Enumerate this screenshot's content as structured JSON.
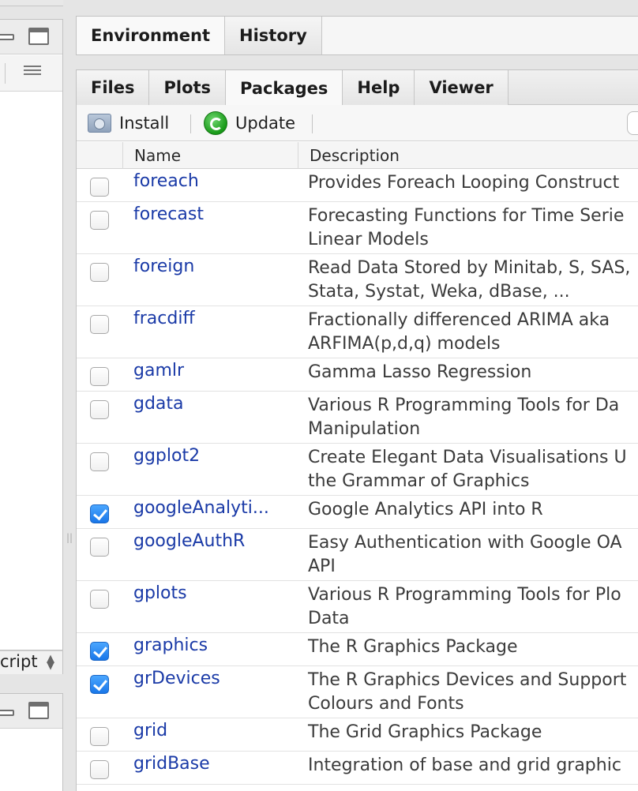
{
  "left_pane": {
    "status_text": "cript"
  },
  "environment_pane": {
    "tabs": [
      {
        "label": "Environment"
      },
      {
        "label": "History"
      }
    ]
  },
  "files_pane": {
    "tabs": [
      {
        "label": "Files",
        "active": false
      },
      {
        "label": "Plots",
        "active": false
      },
      {
        "label": "Packages",
        "active": true
      },
      {
        "label": "Help",
        "active": false
      },
      {
        "label": "Viewer",
        "active": false
      }
    ],
    "toolbar": {
      "install_label": "Install",
      "update_label": "Update"
    },
    "table": {
      "columns": [
        "Name",
        "Description"
      ],
      "rows": [
        {
          "checked": false,
          "name": "foreach",
          "desc": [
            "Provides Foreach Looping Construct"
          ]
        },
        {
          "checked": false,
          "name": "forecast",
          "desc": [
            "Forecasting Functions for Time Serie",
            "Linear Models"
          ]
        },
        {
          "checked": false,
          "name": "foreign",
          "desc": [
            "Read Data Stored by Minitab, S, SAS,",
            "Stata, Systat, Weka, dBase, ..."
          ]
        },
        {
          "checked": false,
          "name": "fracdiff",
          "desc": [
            "Fractionally differenced ARIMA aka",
            "ARFIMA(p,d,q) models"
          ]
        },
        {
          "checked": false,
          "name": "gamlr",
          "desc": [
            "Gamma Lasso Regression"
          ]
        },
        {
          "checked": false,
          "name": "gdata",
          "desc": [
            "Various R Programming Tools for Da",
            "Manipulation"
          ]
        },
        {
          "checked": false,
          "name": "ggplot2",
          "desc": [
            "Create Elegant Data Visualisations U",
            "the Grammar of Graphics"
          ]
        },
        {
          "checked": true,
          "name": "googleAnalyti...",
          "desc": [
            "Google Analytics API into R"
          ]
        },
        {
          "checked": false,
          "name": "googleAuthR",
          "desc": [
            "Easy Authentication with Google OA",
            "API"
          ]
        },
        {
          "checked": false,
          "name": "gplots",
          "desc": [
            "Various R Programming Tools for Plo",
            "Data"
          ]
        },
        {
          "checked": true,
          "name": "graphics",
          "desc": [
            "The R Graphics Package"
          ]
        },
        {
          "checked": true,
          "name": "grDevices",
          "desc": [
            "The R Graphics Devices and Support",
            "Colours and Fonts"
          ]
        },
        {
          "checked": false,
          "name": "grid",
          "desc": [
            "The Grid Graphics Package"
          ]
        },
        {
          "checked": false,
          "name": "gridBase",
          "desc": [
            "Integration of base and grid graphic"
          ]
        }
      ]
    }
  },
  "colors": {
    "link_blue": "#1a3aa7",
    "checkbox_blue": "#1976e8"
  }
}
